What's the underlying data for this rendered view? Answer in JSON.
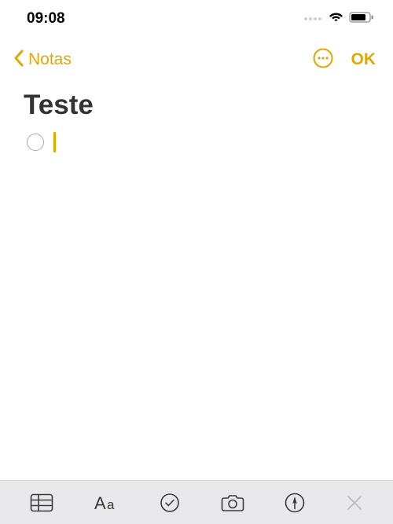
{
  "status_bar": {
    "time": "09:08"
  },
  "nav": {
    "back_label": "Notas",
    "ok_label": "OK"
  },
  "note": {
    "title": "Teste"
  },
  "colors": {
    "accent": "#e0a800"
  }
}
